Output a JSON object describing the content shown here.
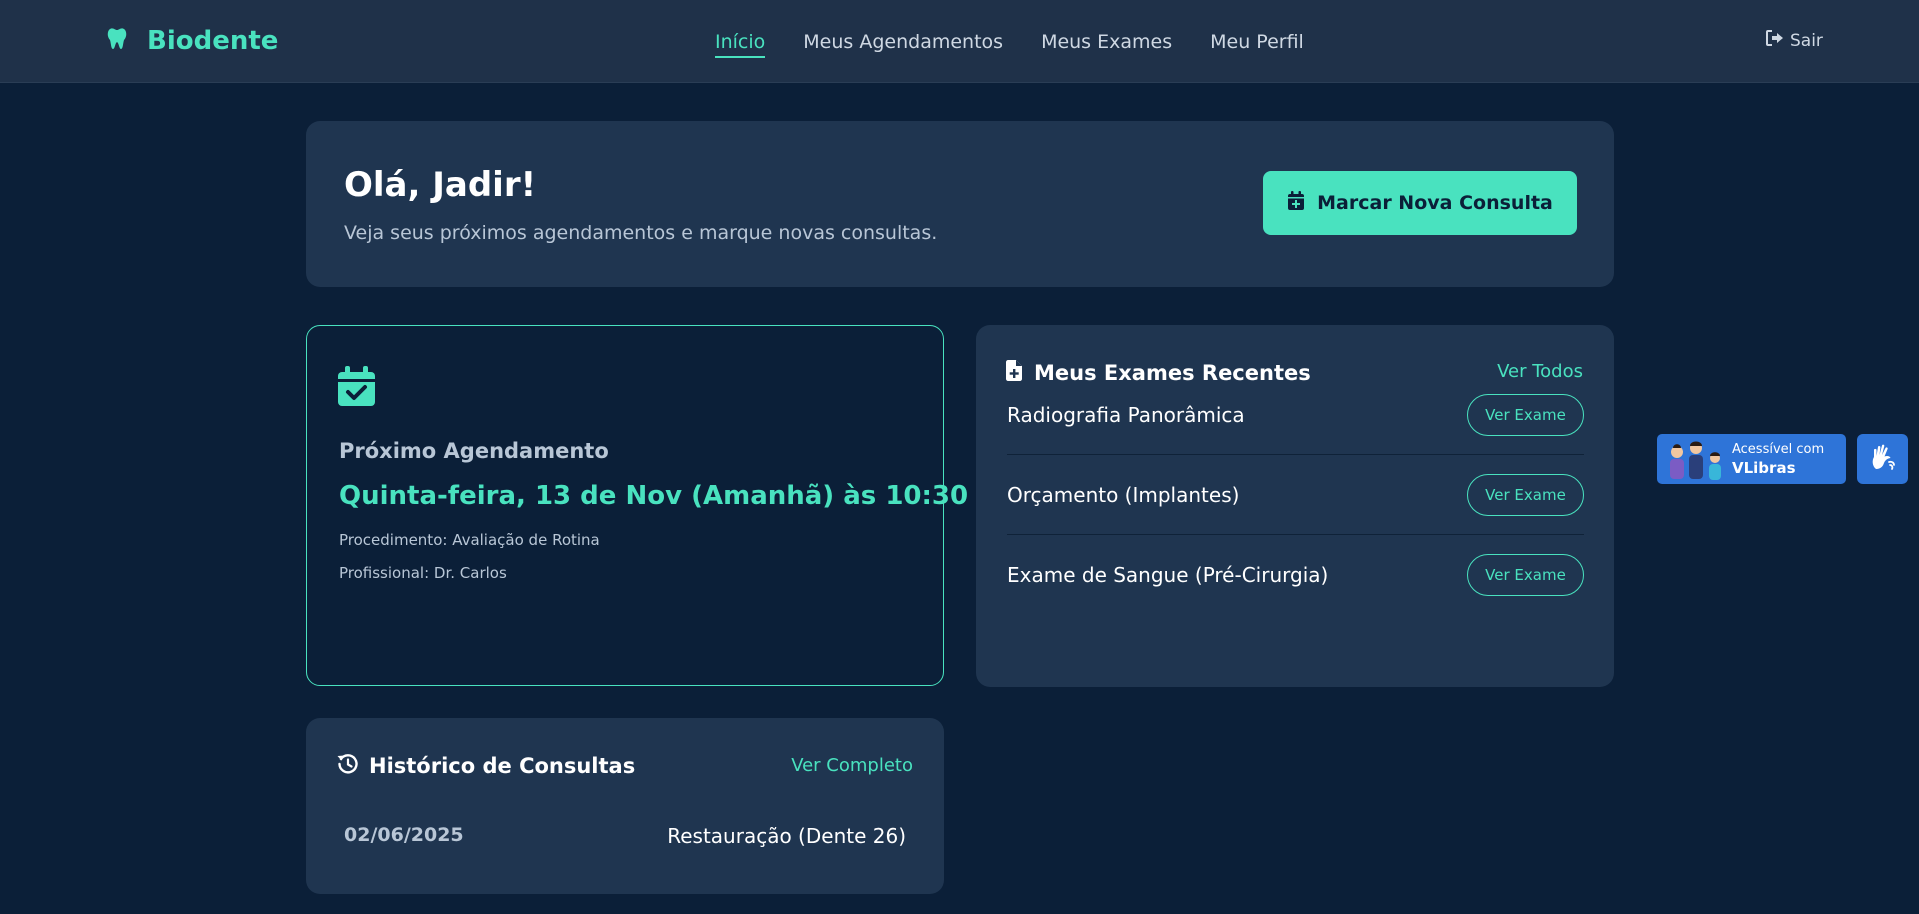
{
  "app": {
    "brand": "Biodente",
    "brand_icon": "tooth-icon"
  },
  "nav": {
    "items": [
      {
        "label": "Início",
        "active": true
      },
      {
        "label": "Meus Agendamentos",
        "active": false
      },
      {
        "label": "Meus Exames",
        "active": false
      },
      {
        "label": "Meu Perfil",
        "active": false
      }
    ],
    "logout_label": "Sair"
  },
  "welcome": {
    "title": "Olá, Jadir!",
    "subtitle": "Veja seus próximos agendamentos e marque novas consultas.",
    "new_button": "Marcar Nova Consulta"
  },
  "next_appointment": {
    "title": "Próximo Agendamento",
    "date": "Quinta-feira, 13 de Nov (Amanhã) às 10:30",
    "procedure": "Procedimento: Avaliação de Rotina",
    "professional": "Profissional: Dr. Carlos"
  },
  "exams": {
    "title": "Meus Exames Recentes",
    "see_all": "Ver Todos",
    "items": [
      {
        "name": "Radiografia Panorâmica",
        "button": "Ver Exame"
      },
      {
        "name": "Orçamento (Implantes)",
        "button": "Ver Exame"
      },
      {
        "name": "Exame de Sangue (Pré-Cirurgia)",
        "button": "Ver Exame"
      }
    ]
  },
  "history": {
    "title": "Histórico de Consultas",
    "see_full": "Ver Completo",
    "items": [
      {
        "date": "02/06/2025",
        "procedure": "Restauração (Dente 26)"
      }
    ]
  },
  "vlibras": {
    "line1": "Acessível com",
    "line2": "VLibras"
  },
  "colors": {
    "background": "#0b1f38",
    "card": "#1f3550",
    "accent": "#49e2bf",
    "vlibras": "#2e74d8"
  }
}
